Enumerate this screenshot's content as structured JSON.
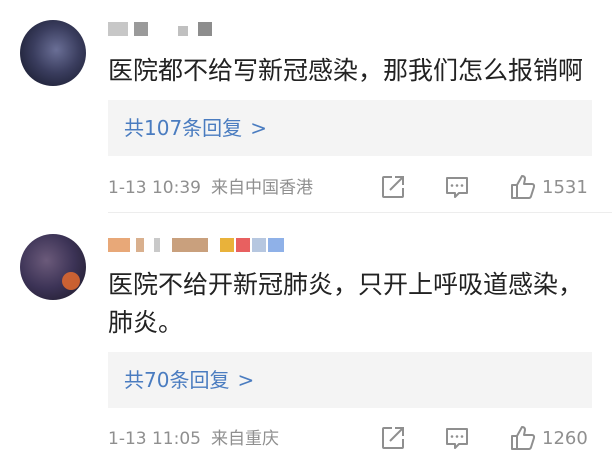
{
  "comments": [
    {
      "text": "医院都不给写新冠感染，那我们怎么报销啊",
      "replies_label": "共107条回复",
      "chevron": ">",
      "time": "1-13 10:39",
      "source": "来自中国香港",
      "likes": "1531"
    },
    {
      "text": "医院不给开新冠肺炎，只开上呼吸道感染，肺炎。",
      "replies_label": "共70条回复",
      "chevron": ">",
      "time": "1-13 11:05",
      "source": "来自重庆",
      "likes": "1260"
    }
  ],
  "icons": {
    "share": "share-icon",
    "comment": "comment-icon",
    "like": "thumbs-up-icon"
  },
  "colors": {
    "link": "#4a7cc0",
    "meta": "#8f8f8f",
    "reply_bg": "#f4f4f4"
  }
}
